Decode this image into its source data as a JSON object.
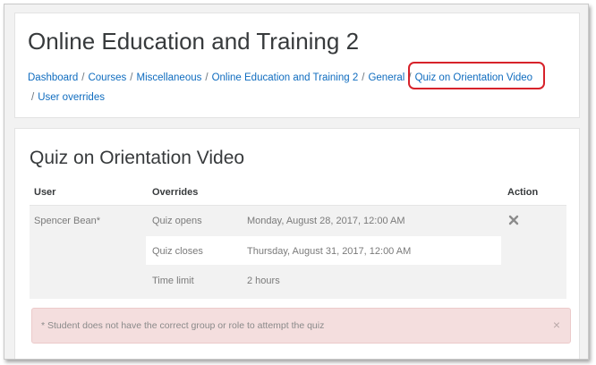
{
  "header": {
    "title": "Online Education and Training 2",
    "breadcrumb": [
      "Dashboard",
      "Courses",
      "Miscellaneous",
      "Online Education and Training 2",
      "General",
      "Quiz on Orientation Video",
      "User overrides"
    ],
    "separator": "/"
  },
  "main": {
    "title": "Quiz on Orientation Video",
    "table": {
      "columns": [
        "User",
        "Overrides",
        "Action"
      ],
      "user": "Spencer Bean*",
      "rows": [
        {
          "setting": "Quiz opens",
          "value": "Monday, August 28, 2017, 12:00 AM"
        },
        {
          "setting": "Quiz closes",
          "value": "Thursday, August 31, 2017, 12:00 AM"
        },
        {
          "setting": "Time limit",
          "value": "2 hours"
        }
      ]
    },
    "alert": {
      "text": "* Student does not have the correct group or role to attempt the quiz",
      "close": "×"
    }
  },
  "colors": {
    "link": "#0f6cbf",
    "highlight": "#d7222a",
    "alert_bg": "#f4dede"
  }
}
